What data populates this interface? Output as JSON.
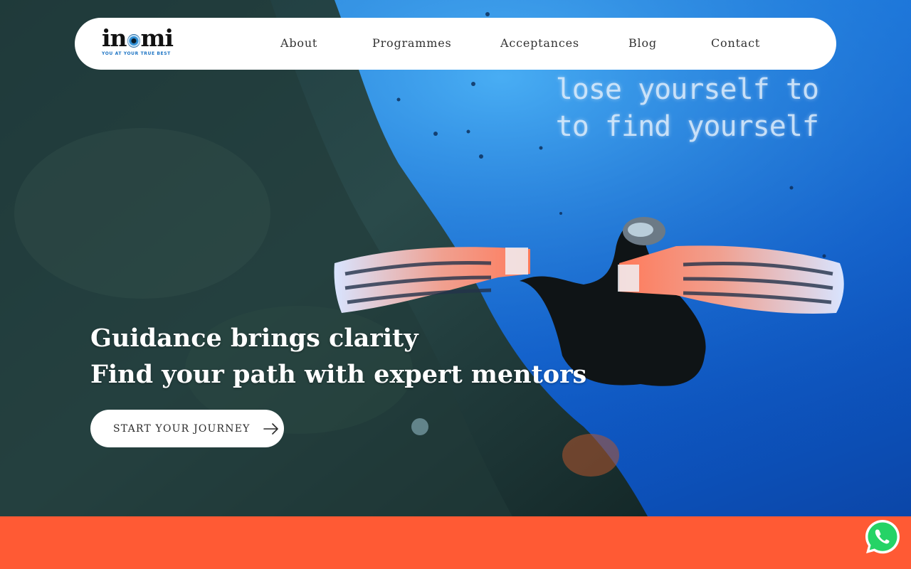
{
  "brand": {
    "name": "inomi",
    "name_left": "in",
    "name_right": "mi",
    "tagline": "YOU AT YOUR TRUE BEST",
    "accent_color": "#1d74c4"
  },
  "nav": {
    "items": [
      {
        "label": "About"
      },
      {
        "label": "Programmes"
      },
      {
        "label": "Acceptances"
      },
      {
        "label": "Blog"
      },
      {
        "label": "Contact"
      }
    ]
  },
  "hero": {
    "video_caption_line1": "lose yourself to",
    "video_caption_line2": "to find yourself",
    "headline_line1": "Guidance brings clarity",
    "headline_line2": "Find your path with expert mentors",
    "cta_label": "START YOUR JOURNEY",
    "cta_icon": "arrow-right-icon"
  },
  "footer_band": {
    "color": "#ff5a34"
  },
  "floating": {
    "whatsapp_icon": "whatsapp-icon",
    "color": "#25d366"
  }
}
